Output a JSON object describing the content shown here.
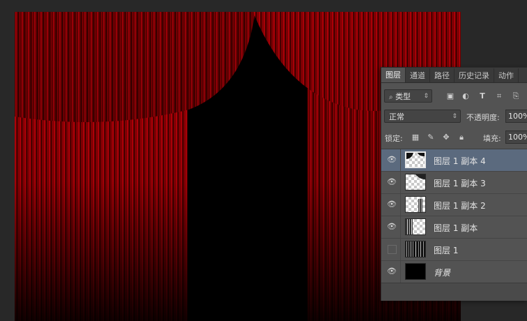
{
  "panel": {
    "tabs": [
      "图层",
      "通道",
      "路径",
      "历史记录",
      "动作"
    ],
    "filter": {
      "icon": "search-icon",
      "value": "类型"
    },
    "filter_icons": [
      "image-filter-icon",
      "adjustment-filter-icon",
      "type-filter-icon",
      "shape-filter-icon",
      "smart-object-filter-icon"
    ],
    "blend_mode": "正常",
    "opacity_label": "不透明度:",
    "opacity_value": "100%",
    "lock_label": "锁定:",
    "lock_icons": [
      "lock-transparent-icon",
      "lock-paint-icon",
      "lock-position-icon",
      "lock-all-icon"
    ],
    "fill_label": "填充:",
    "fill_value": "100%",
    "layers": [
      {
        "name": "图层 1 副本 4",
        "visible": true,
        "selected": true
      },
      {
        "name": "图层 1 副本 3",
        "visible": true,
        "selected": false
      },
      {
        "name": "图层 1 副本 2",
        "visible": true,
        "selected": false
      },
      {
        "name": "图层 1 副本",
        "visible": true,
        "selected": false
      },
      {
        "name": "图层 1",
        "visible": false,
        "selected": false
      },
      {
        "name": "背景",
        "visible": true,
        "selected": false
      }
    ]
  },
  "colors": {
    "curtain": "#8b0000",
    "panel_bg": "#535353",
    "selected_row": "#5b6a7e",
    "app_bg": "#282828"
  }
}
